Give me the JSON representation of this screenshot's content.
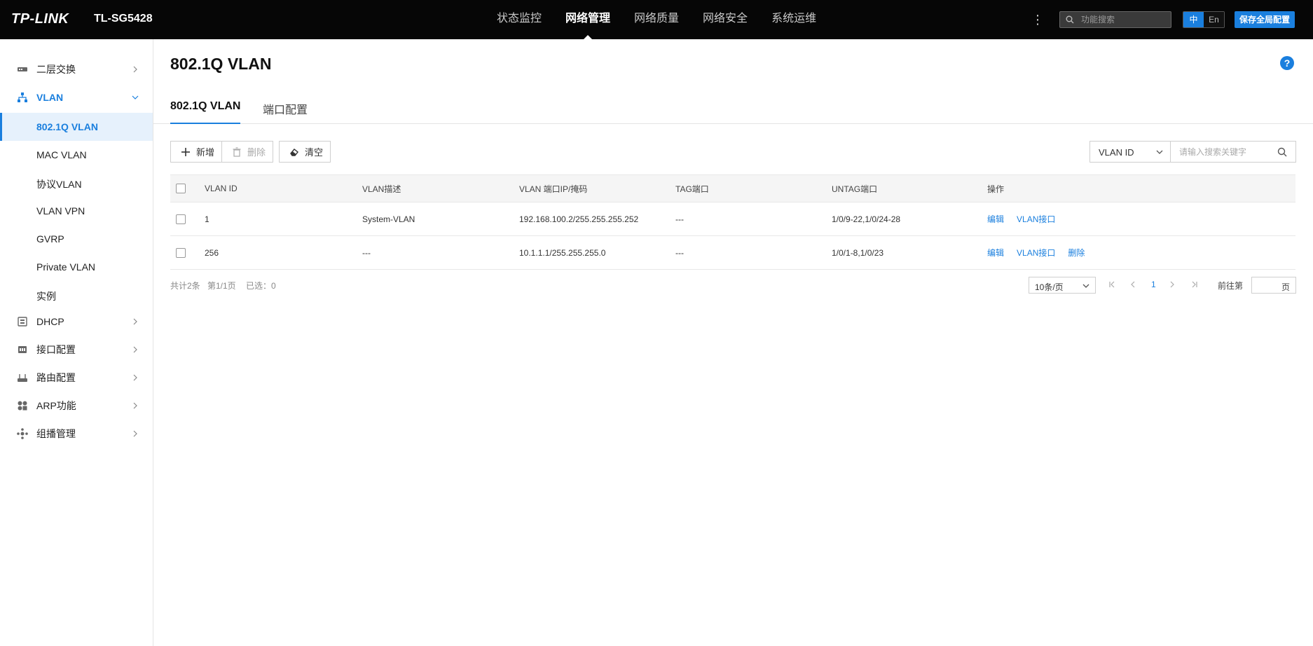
{
  "header": {
    "brand": "TP-LINK",
    "model": "TL-SG5428",
    "nav": [
      "状态监控",
      "网络管理",
      "网络质量",
      "网络安全",
      "系统运维"
    ],
    "nav_active_index": 1,
    "more_icon": "more-vertical-icon",
    "search_placeholder": "功能搜索",
    "lang_zh": "中",
    "lang_en": "En",
    "save_label": "保存全局配置"
  },
  "sidebar": {
    "items": [
      {
        "label": "二层交换",
        "icon": "switch-icon"
      },
      {
        "label": "VLAN",
        "icon": "vlan-icon"
      },
      {
        "label": "DHCP",
        "icon": "dhcp-icon"
      },
      {
        "label": "接口配置",
        "icon": "interface-icon"
      },
      {
        "label": "路由配置",
        "icon": "router-icon"
      },
      {
        "label": "ARP功能",
        "icon": "arp-icon"
      },
      {
        "label": "组播管理",
        "icon": "multicast-icon"
      }
    ],
    "vlan_subitems": [
      "802.1Q VLAN",
      "MAC VLAN",
      "协议VLAN",
      "VLAN VPN",
      "GVRP",
      "Private VLAN",
      "实例"
    ]
  },
  "main": {
    "title": "802.1Q VLAN",
    "help": "?",
    "tabs": [
      "802.1Q VLAN",
      "端口配置"
    ],
    "toolbar": {
      "add": "新增",
      "delete": "删除",
      "clear": "清空"
    },
    "filter": {
      "field": "VLAN ID",
      "placeholder": "请输入搜索关键字"
    },
    "table": {
      "headers": [
        "VLAN ID",
        "VLAN描述",
        "VLAN 端口IP/掩码",
        "TAG端口",
        "UNTAG端口",
        "操作"
      ],
      "rows": [
        {
          "id": "1",
          "desc": "System-VLAN",
          "ip": "192.168.100.2/255.255.255.252",
          "tag": "---",
          "untag": "1/0/9-22,1/0/24-28",
          "ops": [
            "编辑",
            "VLAN接口"
          ]
        },
        {
          "id": "256",
          "desc": "---",
          "ip": "10.1.1.1/255.255.255.0",
          "tag": "---",
          "untag": "1/0/1-8,1/0/23",
          "ops": [
            "编辑",
            "VLAN接口",
            "删除"
          ]
        }
      ]
    },
    "pager": {
      "total": "共计2条",
      "page": "第1/1页",
      "selected": "已选：0",
      "page_size": "10条/页",
      "current": "1",
      "goto_label": "前往第",
      "goto_suffix": "页"
    }
  },
  "colors": {
    "accent": "#1a7fde",
    "header_bg": "#060606"
  }
}
